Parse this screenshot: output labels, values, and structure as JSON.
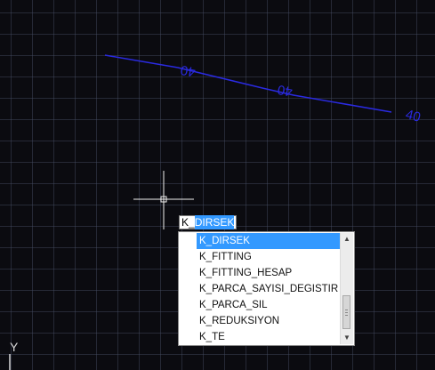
{
  "drawing": {
    "background_color": "#0b0b10",
    "pipe_color": "#2a2ae0",
    "pipe_labels": [
      "40",
      "40",
      "40"
    ],
    "ucs_axis_label": "Y"
  },
  "command_line": {
    "typed_prefix": "K_",
    "highlighted_completion": "DIRSEK"
  },
  "autocomplete": {
    "items": [
      "K_DIRSEK",
      "K_FITTING",
      "K_FITTING_HESAP",
      "K_PARCA_SAYISI_DEGISTIR",
      "K_PARCA_SIL",
      "K_REDUKSIYON",
      "K_TE"
    ],
    "selected_index": 0,
    "selection_color": "#3399ff"
  }
}
